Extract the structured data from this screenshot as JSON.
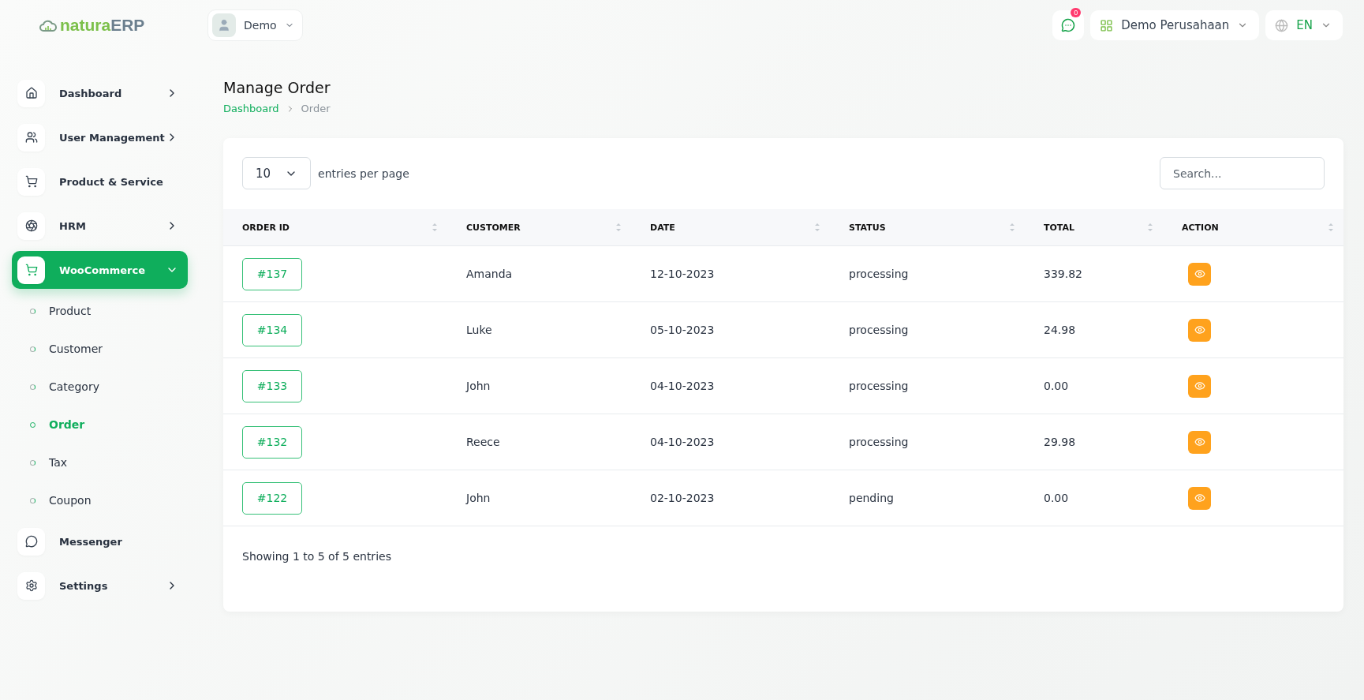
{
  "logo": {
    "part_1": "natura",
    "part_2": "ERP"
  },
  "user_menu": {
    "label": "Demo"
  },
  "notifications": {
    "count": "0"
  },
  "company_menu": {
    "label": "Demo Perusahaan"
  },
  "language_menu": {
    "label": "EN"
  },
  "sidebar": {
    "items": [
      {
        "label": "Dashboard",
        "selected": false,
        "expanded": false
      },
      {
        "label": "User Management",
        "selected": false,
        "expanded": false
      },
      {
        "label": "Product & Service",
        "selected": false
      },
      {
        "label": "HRM",
        "selected": false,
        "expanded": false
      },
      {
        "label": "WooCommerce",
        "selected": true,
        "expanded": true,
        "children": [
          {
            "label": "Product",
            "selected": false
          },
          {
            "label": "Customer",
            "selected": false
          },
          {
            "label": "Category",
            "selected": false
          },
          {
            "label": "Order",
            "selected": true
          },
          {
            "label": "Tax",
            "selected": false
          },
          {
            "label": "Coupon",
            "selected": false
          }
        ]
      },
      {
        "label": "Messenger",
        "selected": false
      },
      {
        "label": "Settings",
        "selected": false,
        "expanded": false
      }
    ]
  },
  "page": {
    "title": "Manage Order",
    "breadcrumb": [
      "Dashboard",
      "Order"
    ]
  },
  "table_controls": {
    "entries_value": "10",
    "entries_label": "entries per page",
    "search_placeholder": "Search..."
  },
  "table": {
    "columns": [
      "ORDER ID",
      "CUSTOMER",
      "DATE",
      "STATUS",
      "TOTAL",
      "ACTION"
    ],
    "rows": [
      {
        "order_id": "#137",
        "customer": "Amanda",
        "date": "12-10-2023",
        "status": "processing",
        "total": "339.82"
      },
      {
        "order_id": "#134",
        "customer": "Luke",
        "date": "05-10-2023",
        "status": "processing",
        "total": "24.98"
      },
      {
        "order_id": "#133",
        "customer": "John",
        "date": "04-10-2023",
        "status": "processing",
        "total": "0.00"
      },
      {
        "order_id": "#132",
        "customer": "Reece",
        "date": "04-10-2023",
        "status": "processing",
        "total": "29.98"
      },
      {
        "order_id": "#122",
        "customer": "John",
        "date": "02-10-2023",
        "status": "pending",
        "total": "0.00"
      }
    ]
  },
  "footer": {
    "summary": "Showing 1 to 5 of 5 entries"
  }
}
